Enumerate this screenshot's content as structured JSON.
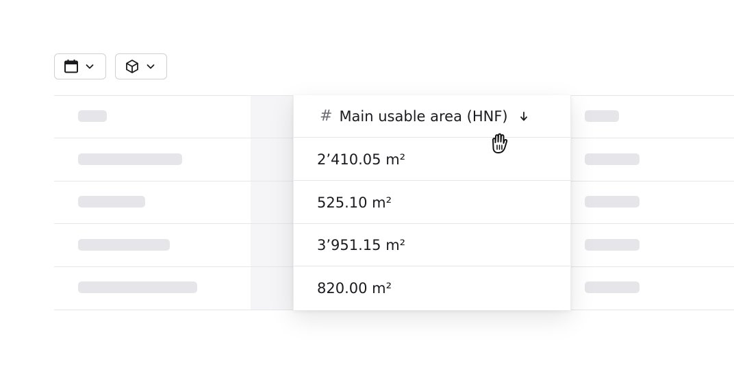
{
  "toolbar": {
    "filters": [
      {
        "icon": "calendar-icon"
      },
      {
        "icon": "cube-icon"
      }
    ]
  },
  "column": {
    "header_icon": "#",
    "header_label": "Main usable area (HNF)",
    "sort": "descending",
    "rows": [
      "2’410.05 m²",
      "525.10 m²",
      "3’951.15 m²",
      "820.00 m²"
    ]
  },
  "colors": {
    "skeleton": "#e6e6ea",
    "border": "#e6e6e9",
    "text": "#1b1b1f"
  }
}
